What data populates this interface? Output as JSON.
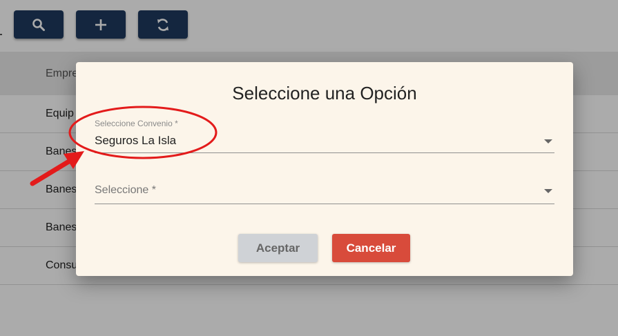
{
  "toolbar": {
    "buttons": [
      {
        "icon": "search-icon"
      },
      {
        "icon": "plus-icon"
      },
      {
        "icon": "refresh-icon"
      }
    ]
  },
  "table": {
    "header": "Empre",
    "rows": [
      "Equip",
      "Banes",
      "Banes",
      "Banes",
      "Consu"
    ]
  },
  "dialog": {
    "title": "Seleccione una Opción",
    "convenio_label": "Seleccione Convenio *",
    "convenio_value": "Seguros La Isla",
    "second_placeholder": "Seleccione *",
    "accept_label": "Aceptar",
    "cancel_label": "Cancelar"
  },
  "colors": {
    "toolbar_button": "#1e3a5f",
    "dialog_bg": "#fcf5ea",
    "cancel_button": "#d84b3b",
    "accept_button": "#cfd2d6",
    "annotation": "#e31b1b"
  }
}
